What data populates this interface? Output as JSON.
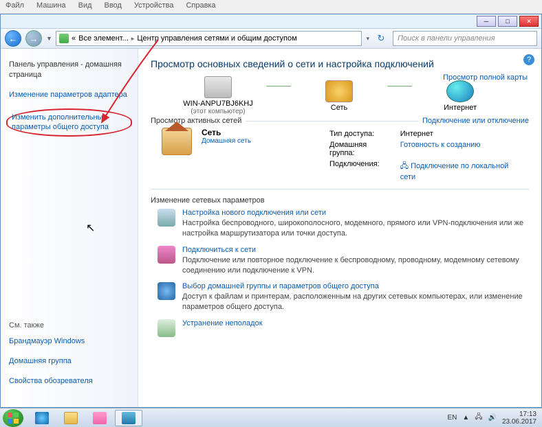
{
  "vm_menu": [
    "Файл",
    "Машина",
    "Вид",
    "Ввод",
    "Устройства",
    "Справка"
  ],
  "breadcrumb": {
    "prefix": "«",
    "part1": "Все элемент...",
    "part2": "Центр управления сетями и общим доступом"
  },
  "search_placeholder": "Поиск в панели управления",
  "sidebar": {
    "home": "Панель управления - домашняя страница",
    "adapter": "Изменение параметров адаптера",
    "advanced": "Изменить дополнительные параметры общего доступа",
    "see_also": "См. также",
    "firewall": "Брандмауэр Windows",
    "homegroup": "Домашняя группа",
    "inet": "Свойства обозревателя"
  },
  "main": {
    "title": "Просмотр основных сведений о сети и настройка подключений",
    "fullmap": "Просмотр полной карты",
    "node_pc": "WIN-ANPU7BJ6KHJ",
    "node_pc_sub": "(этот компьютер)",
    "node_net": "Сеть",
    "node_inet": "Интернет",
    "sec_active": "Просмотр активных сетей",
    "sec_active_link": "Подключение или отключение",
    "net_name": "Сеть",
    "net_type": "Домашняя сеть",
    "prop_access_k": "Тип доступа:",
    "prop_access_v": "Интернет",
    "prop_hg_k": "Домашняя группа:",
    "prop_hg_v": "Готовность к созданию",
    "prop_conn_k": "Подключения:",
    "prop_conn_v": "Подключение по локальной сети",
    "sec_change": "Изменение сетевых параметров",
    "task1_t": "Настройка нового подключения или сети",
    "task1_d": "Настройка беспроводного, широкополосного, модемного, прямого или VPN-подключения или же настройка маршрутизатора или точки доступа.",
    "task2_t": "Подключиться к сети",
    "task2_d": "Подключение или повторное подключение к беспроводному, проводному, модемному сетевому соединению или подключение к VPN.",
    "task3_t": "Выбор домашней группы и параметров общего доступа",
    "task3_d": "Доступ к файлам и принтерам, расположенным на других сетевых компьютерах, или изменение параметров общего доступа.",
    "task4_t": "Устранение неполадок"
  },
  "tray": {
    "lang": "EN",
    "time": "17:13",
    "date": "23.06.2017"
  }
}
